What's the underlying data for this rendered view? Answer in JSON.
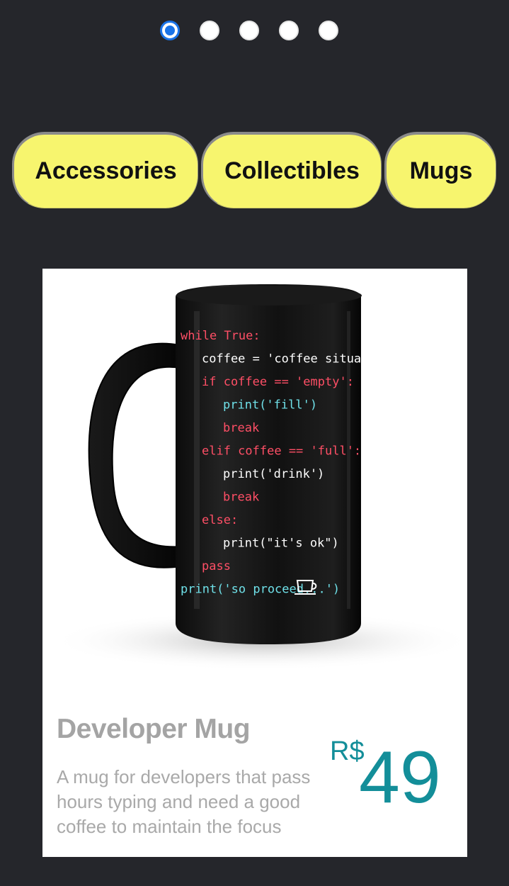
{
  "carousel": {
    "dots": [
      {
        "active": true
      },
      {
        "active": false
      },
      {
        "active": false
      },
      {
        "active": false
      },
      {
        "active": false
      }
    ]
  },
  "categories": [
    {
      "label": "Accessories"
    },
    {
      "label": "Collectibles"
    },
    {
      "label": "Mugs"
    }
  ],
  "product": {
    "image": "coffee-mug-with-code-icon",
    "name": "Developer Mug",
    "description": "A mug for developers that pass hours typing and need a good coffee to maintain the focus",
    "currency": "R$",
    "price": "49",
    "mug_code": [
      {
        "text": "while True:",
        "color": "#ff4f66"
      },
      {
        "text": "coffee = 'coffee situation.'",
        "color": "#ffffff"
      },
      {
        "text": "if coffee == 'empty':",
        "color": "#ff4f66"
      },
      {
        "text": "print('fill')",
        "color": "#6fe0e8"
      },
      {
        "text": "break",
        "color": "#ff4f66"
      },
      {
        "text": "elif coffee == 'full':",
        "color": "#ff4f66"
      },
      {
        "text": "print('drink')",
        "color": "#ffffff"
      },
      {
        "text": "break",
        "color": "#ff4f66"
      },
      {
        "text": "else:",
        "color": "#ff4f66"
      },
      {
        "text": "print(\"it's ok\")",
        "color": "#ffffff"
      },
      {
        "text": "pass",
        "color": "#ff4f66"
      },
      {
        "text": "print('so proceed...')",
        "color": "#6fe0e8"
      }
    ]
  },
  "colors": {
    "background": "#25262b",
    "pill": "#f7f56e",
    "price": "#138e99",
    "active_dot": "#1a73e8"
  }
}
